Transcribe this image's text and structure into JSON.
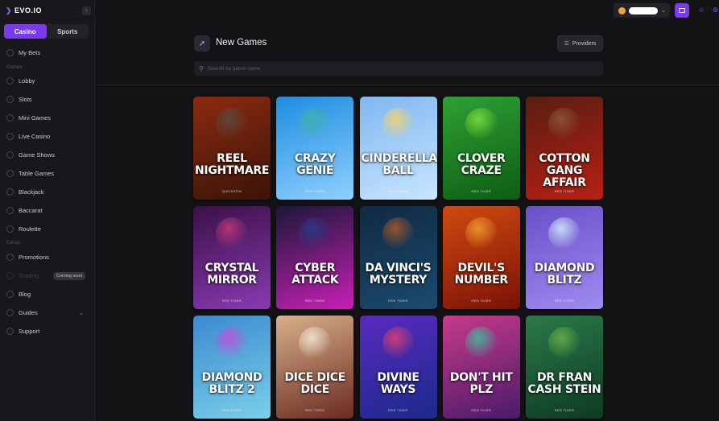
{
  "sidebar": {
    "logo": "EVO.IO",
    "collapse_icon": "chevron-left-icon",
    "mode_tabs": [
      "Casino",
      "Sports"
    ],
    "my_bets": "My Bets",
    "games_label": "Games",
    "games": [
      "Lobby",
      "Slots",
      "Mini Games",
      "Live Casino",
      "Game Shows",
      "Table Games",
      "Blackjack",
      "Baccarat",
      "Roulette"
    ],
    "extra_label": "Extras",
    "promotions": "Promotions",
    "coming_soon_badge": "Coming soon",
    "faded_item": "Trading",
    "blog": "Blog",
    "guides": "Guides",
    "support": "Support"
  },
  "topbar": {
    "coin_icon": "coin-icon",
    "wallet_icon": "wallet-icon",
    "user_icon": "user-icon",
    "settings_icon": "gear-icon"
  },
  "page": {
    "title": "New Games",
    "icon": "rocket-icon",
    "providers_label": "Providers",
    "search_placeholder": "Search by game name"
  },
  "games": [
    {
      "name": "REEL NIGHTMARE",
      "provider": "QUICKSPIN",
      "c1": "#8c2a10",
      "c2": "#3a1408",
      "deco": "#5a4a40"
    },
    {
      "name": "CRAZY GENIE",
      "provider": "RED TIGER",
      "c1": "#1d8de0",
      "c2": "#8fd0ff",
      "deco": "#3fb3a8"
    },
    {
      "name": "CINDERELLA'S BALL",
      "provider": "RED TIGER",
      "c1": "#7fb8f0",
      "c2": "#c9e4ff",
      "deco": "#f2d36b"
    },
    {
      "name": "CLOVER CRAZE",
      "provider": "RED TIGER",
      "c1": "#2fa033",
      "c2": "#0d5d14",
      "deco": "#7ee03c"
    },
    {
      "name": "COTTON GANG AFFAIR",
      "provider": "RED TIGER",
      "c1": "#5a1d12",
      "c2": "#b82014",
      "deco": "#8a5a3a"
    },
    {
      "name": "CRYSTAL MIRROR",
      "provider": "RED TIGER",
      "c1": "#3b1048",
      "c2": "#8a3ab2",
      "deco": "#c4387a"
    },
    {
      "name": "CYBER ATTACK",
      "provider": "RED TIGER",
      "c1": "#1a1838",
      "c2": "#c81fb5",
      "deco": "#2a3a8a"
    },
    {
      "name": "DA VINCI'S MYSTERY",
      "provider": "RED TIGER",
      "c1": "#0f2a44",
      "c2": "#1c4a6e",
      "deco": "#a85a2a"
    },
    {
      "name": "DEVIL'S NUMBER",
      "provider": "RED TIGER",
      "c1": "#d04a10",
      "c2": "#7a1206",
      "deco": "#f2a030"
    },
    {
      "name": "DIAMOND BLITZ",
      "provider": "RED TIGER",
      "c1": "#6a4fc8",
      "c2": "#9e8cf0",
      "deco": "#d4f0ff"
    },
    {
      "name": "DIAMOND BLITZ 2",
      "provider": "RED TIGER",
      "c1": "#3b8ad0",
      "c2": "#7ad0e8",
      "deco": "#c54fe0"
    },
    {
      "name": "DICE DICE DICE",
      "provider": "RED TIGER",
      "c1": "#d8b08a",
      "c2": "#6a2a20",
      "deco": "#f4ead8"
    },
    {
      "name": "DIVINE WAYS",
      "provider": "RED TIGER",
      "c1": "#5a2ac0",
      "c2": "#1a2a8a",
      "deco": "#e0406a"
    },
    {
      "name": "DON'T HIT PLZ",
      "provider": "RED TIGER",
      "c1": "#c83a8a",
      "c2": "#4a1a6a",
      "deco": "#3ac0a0"
    },
    {
      "name": "DR FRAN CASH STEIN",
      "provider": "RED TIGER",
      "c1": "#2a7a4a",
      "c2": "#0e3a22",
      "deco": "#6ab04a"
    }
  ]
}
